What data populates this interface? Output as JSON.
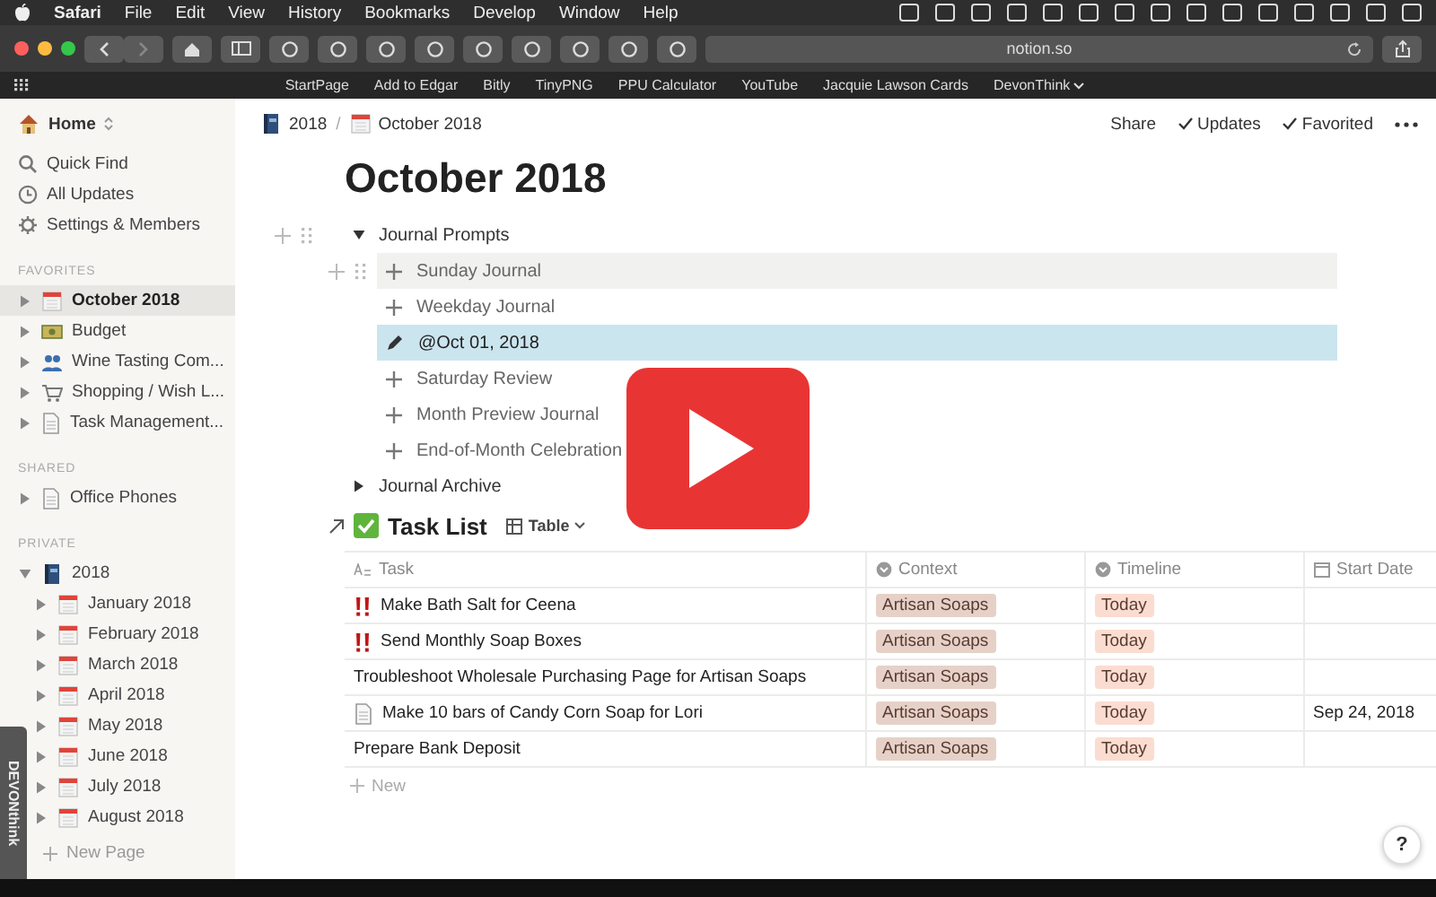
{
  "menubar": {
    "app": "Safari",
    "menus": [
      "File",
      "Edit",
      "View",
      "History",
      "Bookmarks",
      "Develop",
      "Window",
      "Help"
    ]
  },
  "toolbar": {
    "url": "notion.so"
  },
  "bookmarks": [
    {
      "label": "StartPage",
      "dropdown": false
    },
    {
      "label": "Add to Edgar",
      "dropdown": false
    },
    {
      "label": "Bitly",
      "dropdown": false
    },
    {
      "label": "TinyPNG",
      "dropdown": false
    },
    {
      "label": "PPU Calculator",
      "dropdown": false
    },
    {
      "label": "YouTube",
      "dropdown": false
    },
    {
      "label": "Jacquie Lawson Cards",
      "dropdown": false
    },
    {
      "label": "DevonThink",
      "dropdown": true
    }
  ],
  "sidebar": {
    "workspace": "Home",
    "nav": [
      {
        "label": "Quick Find",
        "kind": "search"
      },
      {
        "label": "All Updates",
        "kind": "clock"
      },
      {
        "label": "Settings & Members",
        "kind": "settings"
      }
    ],
    "sections": [
      {
        "title": "FAVORITES",
        "items": [
          {
            "label": "October 2018",
            "kind": "calendar",
            "selected": true,
            "expanded": false
          },
          {
            "label": "Budget",
            "kind": "money",
            "selected": false,
            "expanded": false
          },
          {
            "label": "Wine Tasting Com...",
            "kind": "people",
            "selected": false,
            "expanded": false
          },
          {
            "label": "Shopping / Wish L...",
            "kind": "cart",
            "selected": false,
            "expanded": false
          },
          {
            "label": "Task Management...",
            "kind": "doc",
            "selected": false,
            "expanded": false
          }
        ]
      },
      {
        "title": "SHARED",
        "items": [
          {
            "label": "Office Phones",
            "kind": "doc",
            "selected": false,
            "expanded": false
          }
        ]
      },
      {
        "title": "PRIVATE",
        "items": [
          {
            "label": "2018",
            "kind": "book",
            "selected": false,
            "expanded": true,
            "children": [
              {
                "label": "January 2018",
                "kind": "calendar",
                "selected": false,
                "expanded": false
              },
              {
                "label": "February 2018",
                "kind": "calendar",
                "selected": false,
                "expanded": false
              },
              {
                "label": "March 2018",
                "kind": "calendar",
                "selected": false,
                "expanded": false
              },
              {
                "label": "April 2018",
                "kind": "calendar",
                "selected": false,
                "expanded": false
              },
              {
                "label": "May 2018",
                "kind": "calendar",
                "selected": false,
                "expanded": false
              },
              {
                "label": "June 2018",
                "kind": "calendar",
                "selected": false,
                "expanded": false
              },
              {
                "label": "July 2018",
                "kind": "calendar",
                "selected": false,
                "expanded": false
              },
              {
                "label": "August 2018",
                "kind": "calendar",
                "selected": false,
                "expanded": false
              }
            ]
          }
        ]
      }
    ],
    "new_page": "New Page",
    "side_tab": "DEVONthink"
  },
  "breadcrumb": {
    "separator": "/",
    "items": [
      {
        "label": "2018",
        "kind": "book"
      },
      {
        "label": "October 2018",
        "kind": "calendar"
      }
    ]
  },
  "actions": [
    {
      "label": "Share",
      "checked": false
    },
    {
      "label": "Updates",
      "checked": true
    },
    {
      "label": "Favorited",
      "checked": true
    }
  ],
  "title": "October 2018",
  "blocks": [
    {
      "label": "Journal Prompts",
      "expanded": true,
      "hovered": true,
      "children": [
        {
          "label": "Sunday Journal",
          "kind": "template",
          "hovered": true,
          "selected": false
        },
        {
          "label": "Weekday Journal",
          "kind": "template",
          "hovered": false,
          "selected": false
        },
        {
          "label": "@Oct 01, 2018",
          "kind": "mention",
          "hovered": false,
          "selected": true
        },
        {
          "label": "Saturday Review",
          "kind": "template",
          "hovered": false,
          "selected": false
        },
        {
          "label": "Month Preview Journal",
          "kind": "template",
          "hovered": false,
          "selected": false
        },
        {
          "label": "End-of-Month Celebration",
          "kind": "template",
          "hovered": false,
          "selected": false
        }
      ]
    },
    {
      "label": "Journal Archive",
      "expanded": false,
      "hovered": false
    }
  ],
  "database": {
    "title": "Task List",
    "view": "Table",
    "columns": [
      {
        "label": "Task",
        "kind": "title"
      },
      {
        "label": "Context",
        "kind": "select"
      },
      {
        "label": "Timeline",
        "kind": "select"
      },
      {
        "label": "Start Date",
        "kind": "date"
      }
    ],
    "rows": [
      {
        "kind": "priority",
        "task": "Make Bath Salt for Ceena",
        "context": "Artisan Soaps",
        "timeline": "Today"
      },
      {
        "kind": "priority",
        "task": "Send Monthly Soap Boxes",
        "context": "Artisan Soaps",
        "timeline": "Today"
      },
      {
        "kind": "plain",
        "task": "Troubleshoot Wholesale Purchasing Page for Artisan Soaps",
        "context": "Artisan Soaps",
        "timeline": "Today"
      },
      {
        "kind": "doc",
        "task": "Make 10 bars of Candy Corn Soap for Lori",
        "context": "Artisan Soaps",
        "timeline": "Today",
        "start_date": "Sep 24, 2018"
      },
      {
        "kind": "plain",
        "task": "Prepare Bank Deposit",
        "context": "Artisan Soaps",
        "timeline": "Today"
      }
    ],
    "new_row": "New"
  },
  "help": "?"
}
